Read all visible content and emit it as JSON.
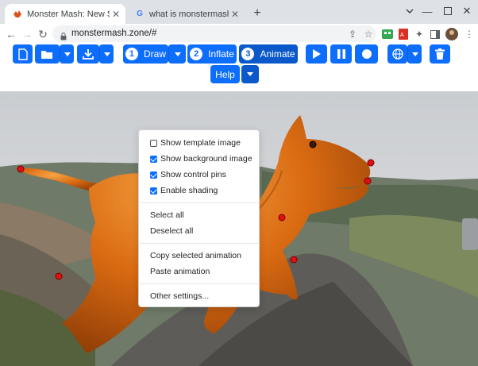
{
  "browser": {
    "tabs": [
      {
        "title": "Monster Mash: New Sketch-Base",
        "favicon": "monster-icon"
      },
      {
        "title": "what is monstermash? - Google S",
        "favicon": "google-icon"
      }
    ],
    "new_tab": "+",
    "url": "monstermash.zone/#"
  },
  "app": {
    "modes": {
      "draw": {
        "num": "1",
        "label": "Draw"
      },
      "inflate": {
        "num": "2",
        "label": "Inflate"
      },
      "animate": {
        "num": "3",
        "label": "Animate"
      }
    },
    "help_label": "Help",
    "menu": {
      "checks": [
        {
          "label": "Show template image",
          "checked": false
        },
        {
          "label": "Show background image",
          "checked": true
        },
        {
          "label": "Show control pins",
          "checked": true
        },
        {
          "label": "Enable shading",
          "checked": true
        }
      ],
      "select_all": "Select all",
      "deselect_all": "Deselect all",
      "copy_animation": "Copy selected animation",
      "paste_animation": "Paste animation",
      "other_settings": "Other settings..."
    },
    "colors": {
      "accent": "#0d6efd",
      "accent_dark": "#0a58ca",
      "monster": "#e07a1a",
      "pin": "#e01010"
    }
  }
}
